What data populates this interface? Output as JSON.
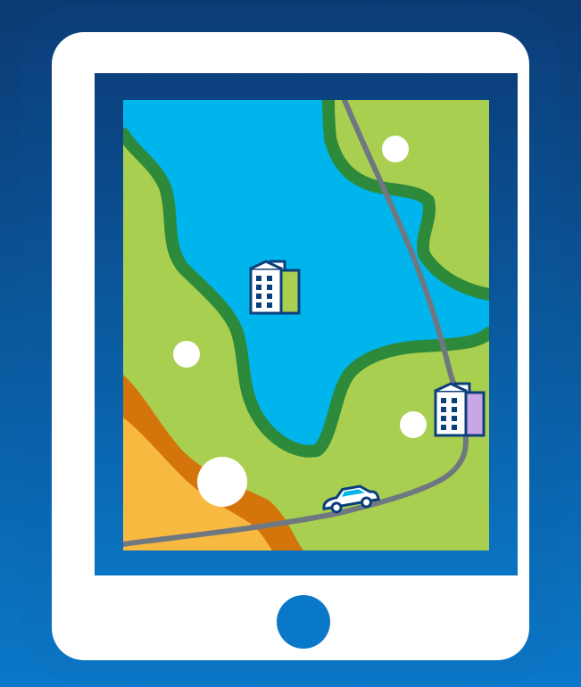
{
  "illustration": {
    "subject": "tablet-showing-map",
    "icons": [
      "building-icon",
      "building-icon",
      "car-icon",
      "location-dot-icon",
      "home-button-icon"
    ]
  },
  "colors": {
    "background_top": "#0b3a73",
    "background_bottom": "#0a78c8",
    "tablet_body": "#ffffff",
    "screen_frame_top": "#0b3f7c",
    "screen_frame_bottom": "#0a74c2",
    "water": "#00b4ec",
    "land": "#a9cf50",
    "river_bank": "#2e8a3b",
    "desert": "#f8b941",
    "desert_edge": "#d4750c",
    "road": "#6f7880",
    "dot": "#ffffff",
    "home_button": "#0a78c8"
  }
}
